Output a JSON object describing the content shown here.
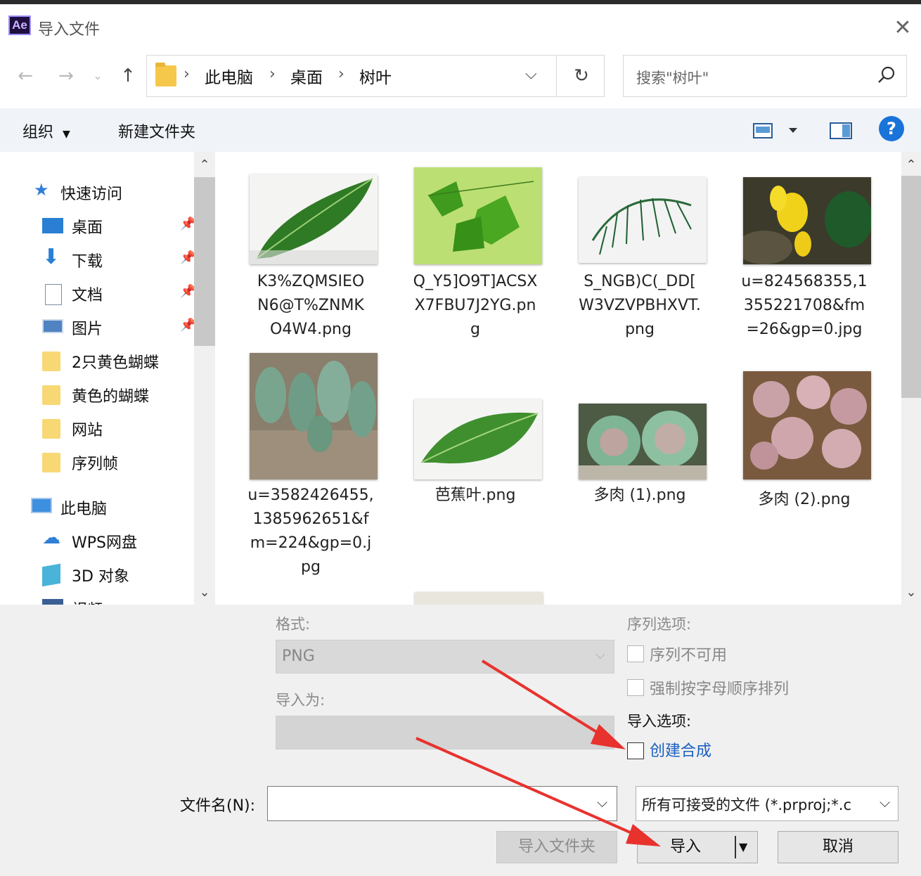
{
  "window": {
    "title": "导入文件",
    "app_logo": "Ae",
    "close_icon": "close-icon"
  },
  "nav": {
    "breadcrumb": [
      "此电脑",
      "桌面",
      "树叶"
    ],
    "search_placeholder": "搜索\"树叶\""
  },
  "toolbar": {
    "organize_label": "组织",
    "new_folder_label": "新建文件夹",
    "help_label": "?"
  },
  "sidebar": {
    "items": [
      {
        "label": "快速访问",
        "icon": "star-icon"
      },
      {
        "label": "桌面",
        "icon": "desktop-icon",
        "pinned": true
      },
      {
        "label": "下载",
        "icon": "download-icon",
        "pinned": true
      },
      {
        "label": "文档",
        "icon": "document-icon",
        "pinned": true
      },
      {
        "label": "图片",
        "icon": "pictures-icon",
        "pinned": true
      },
      {
        "label": "2只黄色蝴蝶",
        "icon": "folder-icon"
      },
      {
        "label": "黄色的蝴蝶",
        "icon": "folder-icon"
      },
      {
        "label": "网站",
        "icon": "folder-icon"
      },
      {
        "label": "序列帧",
        "icon": "folder-icon"
      },
      {
        "label": "此电脑",
        "icon": "computer-icon"
      },
      {
        "label": "WPS网盘",
        "icon": "cloud-icon"
      },
      {
        "label": "3D 对象",
        "icon": "3d-objects-icon"
      },
      {
        "label": "视频",
        "icon": "video-icon"
      }
    ]
  },
  "files": [
    {
      "name": "K3%ZQMSIEO\nN6@T%ZNMK\nO4W4.png"
    },
    {
      "name": "Q_Y5]O9T]ACSX\nX7FBU7J2YG.pn\ng"
    },
    {
      "name": "S_NGB)C(_DD[\nW3VZVPBHXVT.\npng"
    },
    {
      "name": "u=824568355,1\n355221708&fm\n=26&gp=0.jpg"
    },
    {
      "name": "u=3582426455,\n1385962651&f\nm=224&gp=0.j\npg"
    },
    {
      "name": "芭蕉叶.png"
    },
    {
      "name": "多肉 (1).png"
    },
    {
      "name": "多肉 (2).png"
    }
  ],
  "options": {
    "format_label": "格式:",
    "format_value": "PNG",
    "import_as_label": "导入为:",
    "sequence_options_label": "序列选项:",
    "sequence_unavailable": "序列不可用",
    "force_alphabetical": "强制按字母顺序排列",
    "import_options_label": "导入选项:",
    "create_composition": "创建合成"
  },
  "footer": {
    "filename_label": "文件名(N):",
    "filename_value": "",
    "filetype_value": "所有可接受的文件 (*.prproj;*.c",
    "import_folder_button": "导入文件夹",
    "import_button": "导入",
    "cancel_button": "取消"
  },
  "colors": {
    "accent": "#1a73d9",
    "annotation_arrow": "#e8322e",
    "toolbar_bg": "#f0f4f9",
    "panel_bg": "#f0f0f0"
  }
}
